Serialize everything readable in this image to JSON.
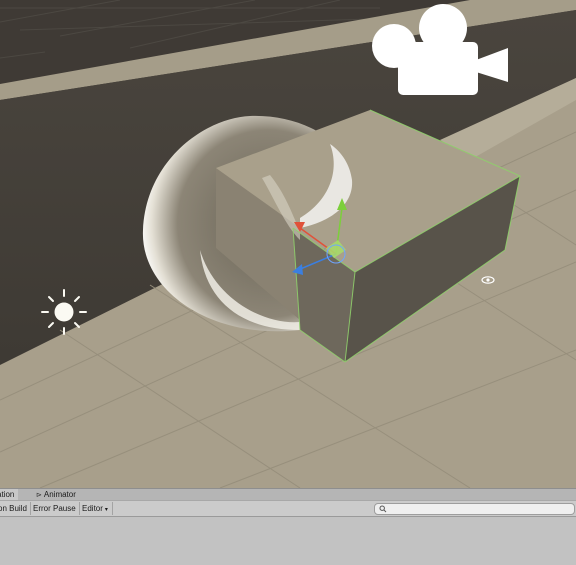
{
  "tabs": {
    "animation": "ation",
    "animator": "Animator",
    "animator_icon": "animator-icon"
  },
  "console_toolbar": {
    "build_label": "on Build",
    "error_pause_label": "Error Pause",
    "editor_label": "Editor",
    "editor_caret": "▾",
    "search_icon": "search-icon",
    "search_placeholder": ""
  },
  "scene_icons": {
    "light": "sun-icon",
    "camera": "camera-icon",
    "gizmo": "move-gizmo",
    "visibility": "eye-icon"
  },
  "colors": {
    "background_dark": "#3d3833",
    "wall": "#4f4a42",
    "floor": "#a8a08c",
    "cube_top": "#a9a08c",
    "selection_outline": "#8fd06b",
    "axis_x": "#e0523a",
    "axis_y": "#7ccf3b",
    "axis_z": "#3b7fe0"
  }
}
